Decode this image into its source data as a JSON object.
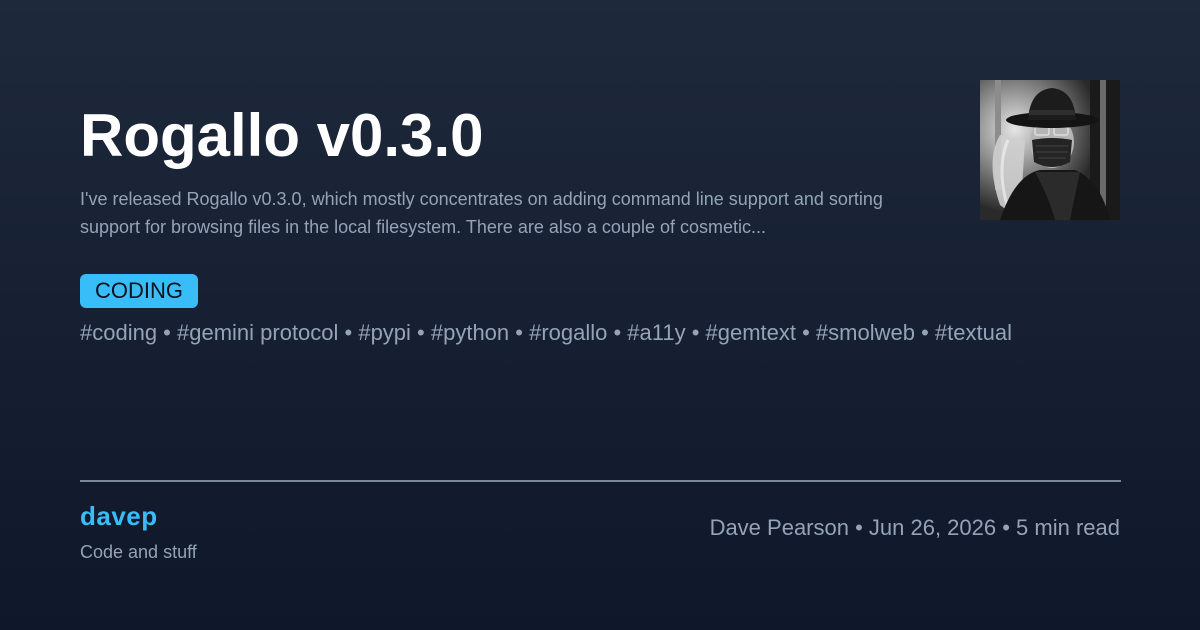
{
  "post": {
    "title": "Rogallo v0.3.0",
    "excerpt": "I've released Rogallo v0.3.0, which mostly concentrates on adding command line support and sorting support for browsing files in the local filesystem. There are also a couple of cosmetic...",
    "category": "CODING",
    "tags": "#coding • #gemini protocol • #pypi • #python • #rogallo • #a11y • #gemtext • #smolweb • #textual"
  },
  "site": {
    "name": "davep",
    "tagline": "Code and stuff"
  },
  "meta": "Dave Pearson • Jun 26, 2026 • 5 min read",
  "colors": {
    "accent": "#38bdf8",
    "text": "#ffffff",
    "muted": "#94a3b8",
    "background_top": "#1e293b",
    "background_bottom": "#0f172a"
  },
  "avatar": {
    "icon": "author-avatar"
  }
}
